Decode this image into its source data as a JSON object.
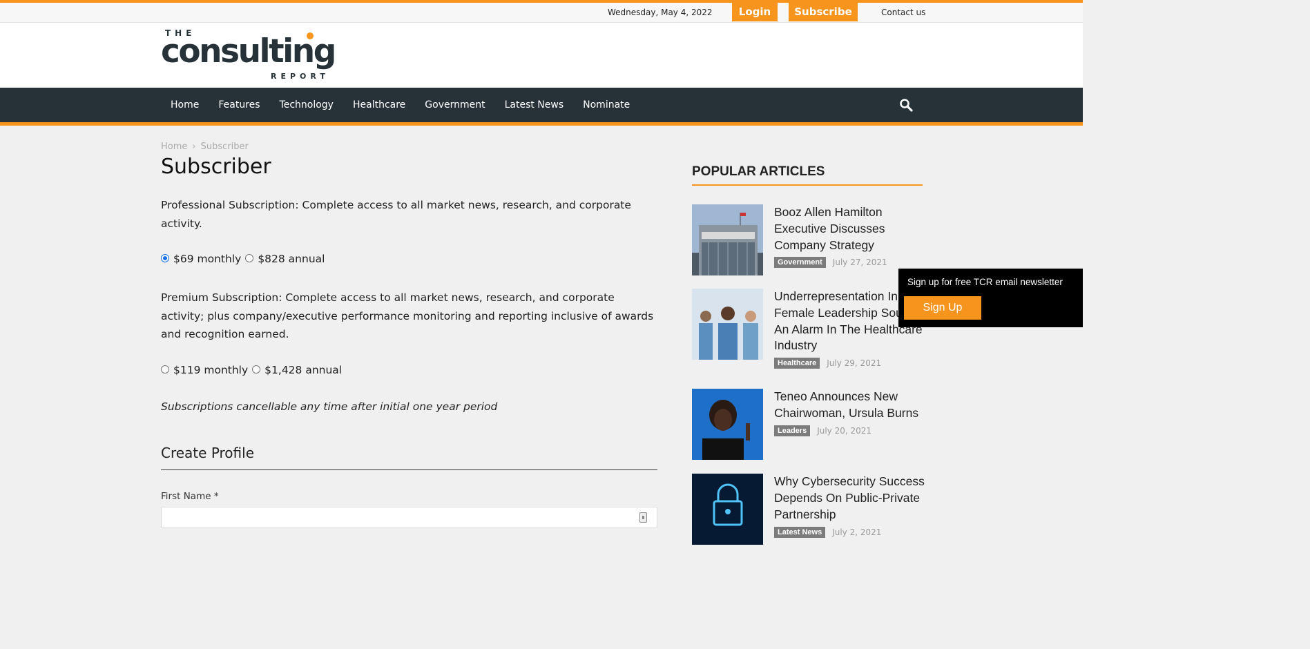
{
  "topbar": {
    "date": "Wednesday, May 4, 2022",
    "login_label": "Login",
    "subscribe_label": "Subscribe",
    "contact_label": "Contact us"
  },
  "logo": {
    "the": "THE",
    "main": "consulting",
    "report": "REPORT"
  },
  "nav": {
    "items": [
      "Home",
      "Features",
      "Technology",
      "Healthcare",
      "Government",
      "Latest News",
      "Nominate"
    ],
    "search_icon": "search-icon"
  },
  "breadcrumb": {
    "home": "Home",
    "current": "Subscriber",
    "separator": "›"
  },
  "page": {
    "title": "Subscriber",
    "professional_text": "Professional Subscription: Complete access to all market news, research, and corporate activity.",
    "professional_options": [
      "$69 monthly",
      "$828 annual"
    ],
    "professional_selected": "$69 monthly",
    "premium_text": "Premium Subscription: Complete access to all market news, research, and corporate activity; plus company/executive performance monitoring and reporting inclusive of awards and recognition earned.",
    "premium_options": [
      "$119 monthly",
      "$1,428 annual"
    ],
    "cancel_note": "Subscriptions cancellable any time after initial one year period",
    "create_profile": "Create Profile",
    "first_name_label": "First Name *",
    "first_name_value": ""
  },
  "sidebar": {
    "title": "POPULAR ARTICLES",
    "articles": [
      {
        "headline": "Booz Allen Hamilton Executive Discusses Company Strategy",
        "tag": "Government",
        "date": "July 27, 2021"
      },
      {
        "headline": "Underrepresentation In Female Leadership Sounds An Alarm In The Healthcare Industry",
        "tag": "Healthcare",
        "date": "July 29, 2021"
      },
      {
        "headline": "Teneo Announces New Chairwoman, Ursula Burns",
        "tag": "Leaders",
        "date": "July 20, 2021"
      },
      {
        "headline": "Why Cybersecurity Success Depends On Public-Private Partnership",
        "tag": "Latest News",
        "date": "July 2, 2021"
      }
    ]
  },
  "popup": {
    "message": "Sign up for free TCR email newsletter",
    "button": "Sign Up"
  },
  "colors": {
    "accent": "#f7941d",
    "nav_bg": "#263238",
    "tag_bg": "#7b7b7b"
  }
}
